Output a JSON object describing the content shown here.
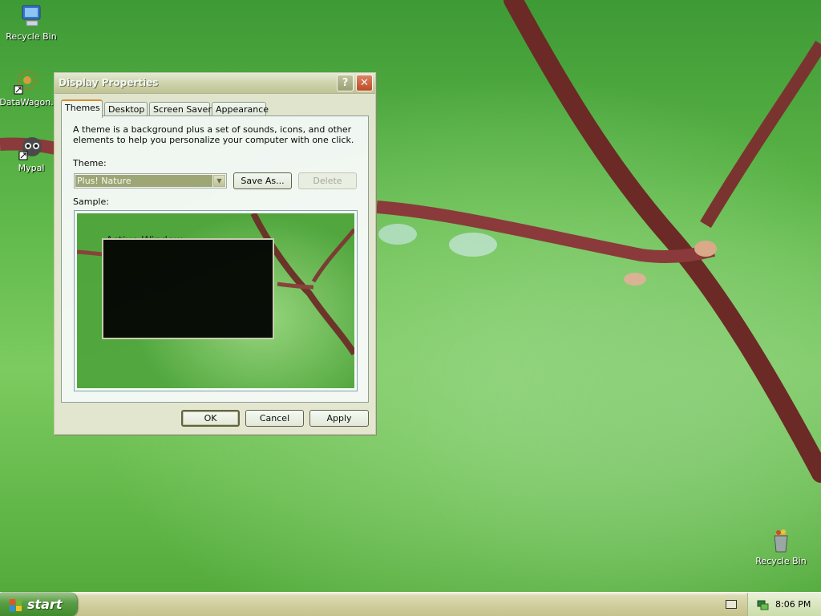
{
  "desktop": {
    "icons": [
      {
        "label": "Recycle Bin",
        "icon": "computer-icon"
      },
      {
        "label": "DataWagon.",
        "icon": "datawagon-shortcut-icon"
      },
      {
        "label": "Mypal",
        "icon": "mypal-browser-icon"
      },
      {
        "label": "Recycle Bin",
        "icon": "recycle-bin-full-icon"
      }
    ]
  },
  "window": {
    "title": "Display Properties",
    "help_glyph": "?",
    "close_glyph": "✕",
    "tabs": [
      "Themes",
      "Desktop",
      "Screen Saver",
      "Appearance"
    ],
    "active_tab": "Themes",
    "intro": "A theme is a background plus a set of sounds, icons, and other elements to help you personalize your computer with one click.",
    "theme_label": "Theme:",
    "theme_value": "Plus! Nature",
    "save_as_label": "Save As...",
    "delete_label": "Delete",
    "sample_label": "Sample:",
    "sample_window_title": "Active Window",
    "ok_label": "OK",
    "cancel_label": "Cancel",
    "apply_label": "Apply"
  },
  "taskbar": {
    "start_label": "start",
    "clock": "8:06 PM"
  },
  "colors": {
    "wallpaper_green": "#5fb84a",
    "branch": "#7a2e2a",
    "window_face": "#ece9d8",
    "start_green": "#3f8a2c"
  }
}
